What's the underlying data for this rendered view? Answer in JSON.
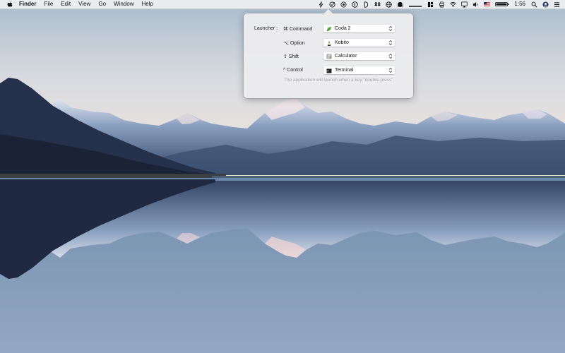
{
  "menubar": {
    "app_name": "Finder",
    "menus": [
      "File",
      "Edit",
      "View",
      "Go",
      "Window",
      "Help"
    ],
    "status_icons": [
      "lightning-icon",
      "checkmark-icon",
      "eye-icon",
      "info-icon",
      "d-icon",
      "dropbox-icon",
      "globe-icon",
      "ghost-icon",
      "line-icon",
      "grid-icon",
      "printer-icon",
      "wifi-icon",
      "airplay-icon",
      "volume-icon",
      "us-flag-icon",
      "battery-icon"
    ],
    "clock": "1:56",
    "search_icon": "search-icon",
    "user_icon": "user-icon",
    "list_icon": "list-icon"
  },
  "popover": {
    "launcher_label": "Launcher :",
    "rows": [
      {
        "key": "⌘ Command",
        "app": "Coda 2",
        "icon": "leaf-icon"
      },
      {
        "key": "⌥ Option",
        "app": "Kobito",
        "icon": "kobito-icon"
      },
      {
        "key": "⇧ Shift",
        "app": "Calculator",
        "icon": "calculator-icon"
      },
      {
        "key": "^ Control",
        "app": "Terminal",
        "icon": "terminal-icon"
      }
    ],
    "hint": "The application will launch when a key \"double-press\"."
  },
  "colors": {
    "menubar_bg": "#f0f0f2",
    "popover_bg": "#ececee",
    "sky_top": "#a8bccd",
    "lake": "#5a7a9e"
  }
}
